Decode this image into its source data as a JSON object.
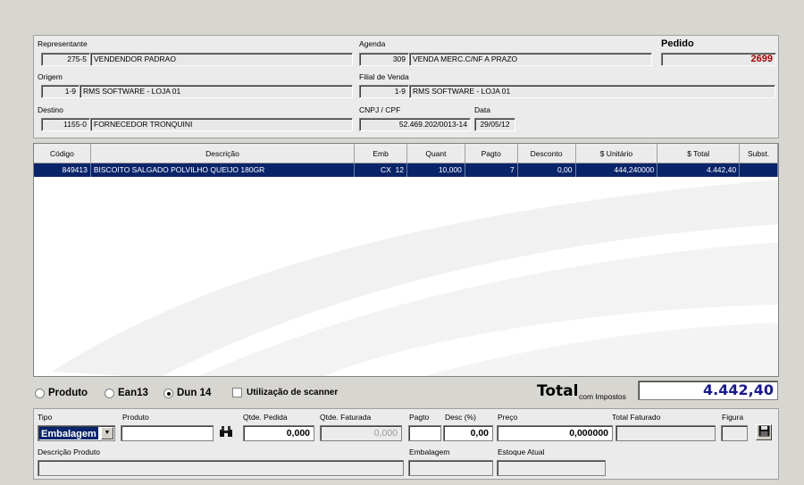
{
  "header": {
    "representante": {
      "label": "Representante",
      "code": "275-5",
      "name": "VENDENDOR PADRAO"
    },
    "agenda": {
      "label": "Agenda",
      "code": "309",
      "name": "VENDA MERC.C/NF A PRAZO"
    },
    "pedido": {
      "label": "Pedido",
      "value": "2699"
    },
    "origem": {
      "label": "Origem",
      "code": "1-9",
      "name": "RMS SOFTWARE - LOJA 01"
    },
    "filial": {
      "label": "Filial de Venda",
      "code": "1-9",
      "name": "RMS SOFTWARE - LOJA 01"
    },
    "destino": {
      "label": "Destino",
      "code": "1155-0",
      "name": "FORNECEDOR TRONQUINI"
    },
    "cnpj": {
      "label": "CNPJ / CPF",
      "value": "52.469.202/0013-14"
    },
    "data": {
      "label": "Data",
      "value": "29/05/12"
    }
  },
  "grid": {
    "columns": [
      "Código",
      "Descrição",
      "Emb",
      "Quant",
      "Pagto",
      "Desconto",
      "$ Unitário",
      "$ Total",
      "Subst."
    ],
    "rows": [
      {
        "codigo": "849413",
        "descricao": "BISCOITO SALGADO POLVILHO QUEIJO 180GR",
        "emb": "CX  12",
        "quant": "10,000",
        "pagto": "7",
        "desconto": "0,00",
        "unitario": "444,240000",
        "total": "4.442,40",
        "subst": ""
      }
    ]
  },
  "options": {
    "radio_produto": "Produto",
    "radio_ean13": "Ean13",
    "radio_dun14": "Dun 14",
    "scanner": "Utilização de scanner",
    "total_label": "Total",
    "total_sub": "com Impostos",
    "total_value": "4.442,40"
  },
  "entry": {
    "tipo_label": "Tipo",
    "tipo_value": "Embalagem",
    "produto_label": "Produto",
    "qtde_pedida_label": "Qtde. Pedida",
    "qtde_pedida_value": "0,000",
    "qtde_faturada_label": "Qtde. Faturada",
    "qtde_faturada_value": "0,000",
    "pagto_label": "Pagto",
    "desc_label": "Desc (%)",
    "desc_value": "0,00",
    "preco_label": "Preço",
    "preco_value": "0,000000",
    "total_faturado_label": "Total Faturado",
    "figura_label": "Figura",
    "descricao_label": "Descrição Produto",
    "embalagem_label": "Embalagem",
    "estoque_label": "Estoque Atual"
  },
  "colors": {
    "selection": "#0a246a",
    "total_value": "#1a1a8c",
    "pedido": "#a00000"
  },
  "icons": {
    "search": "binoculars-icon",
    "save": "floppy-disk-icon",
    "dropdown": "chevron-down-icon"
  }
}
